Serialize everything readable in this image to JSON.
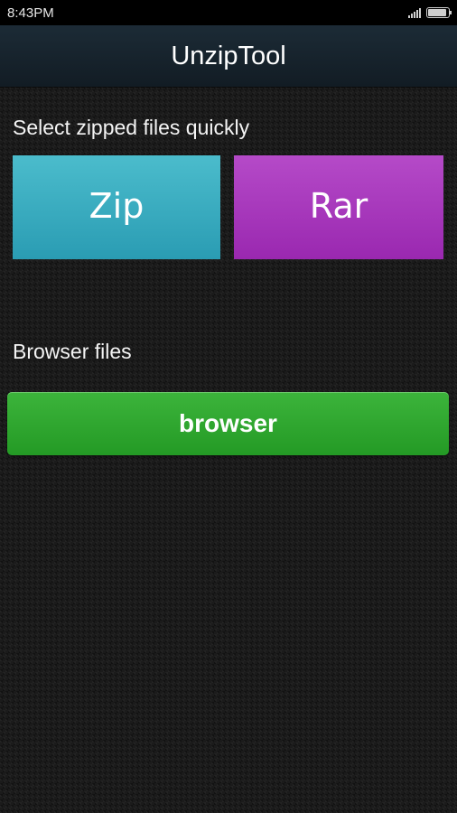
{
  "status_bar": {
    "time": "8:43PM",
    "signal_icon": "signal-icon",
    "battery_icon": "battery-icon",
    "battery_level": 0.9
  },
  "app_bar": {
    "title": "UnzipTool"
  },
  "quick_select": {
    "label": "Select zipped files quickly",
    "zip_label": "Zip",
    "rar_label": "Rar",
    "zip_color": "#3fb3c6",
    "rar_color": "#a936bd"
  },
  "browser_section": {
    "label": "Browser files",
    "button_label": "browser",
    "button_color": "#2fa82f"
  }
}
